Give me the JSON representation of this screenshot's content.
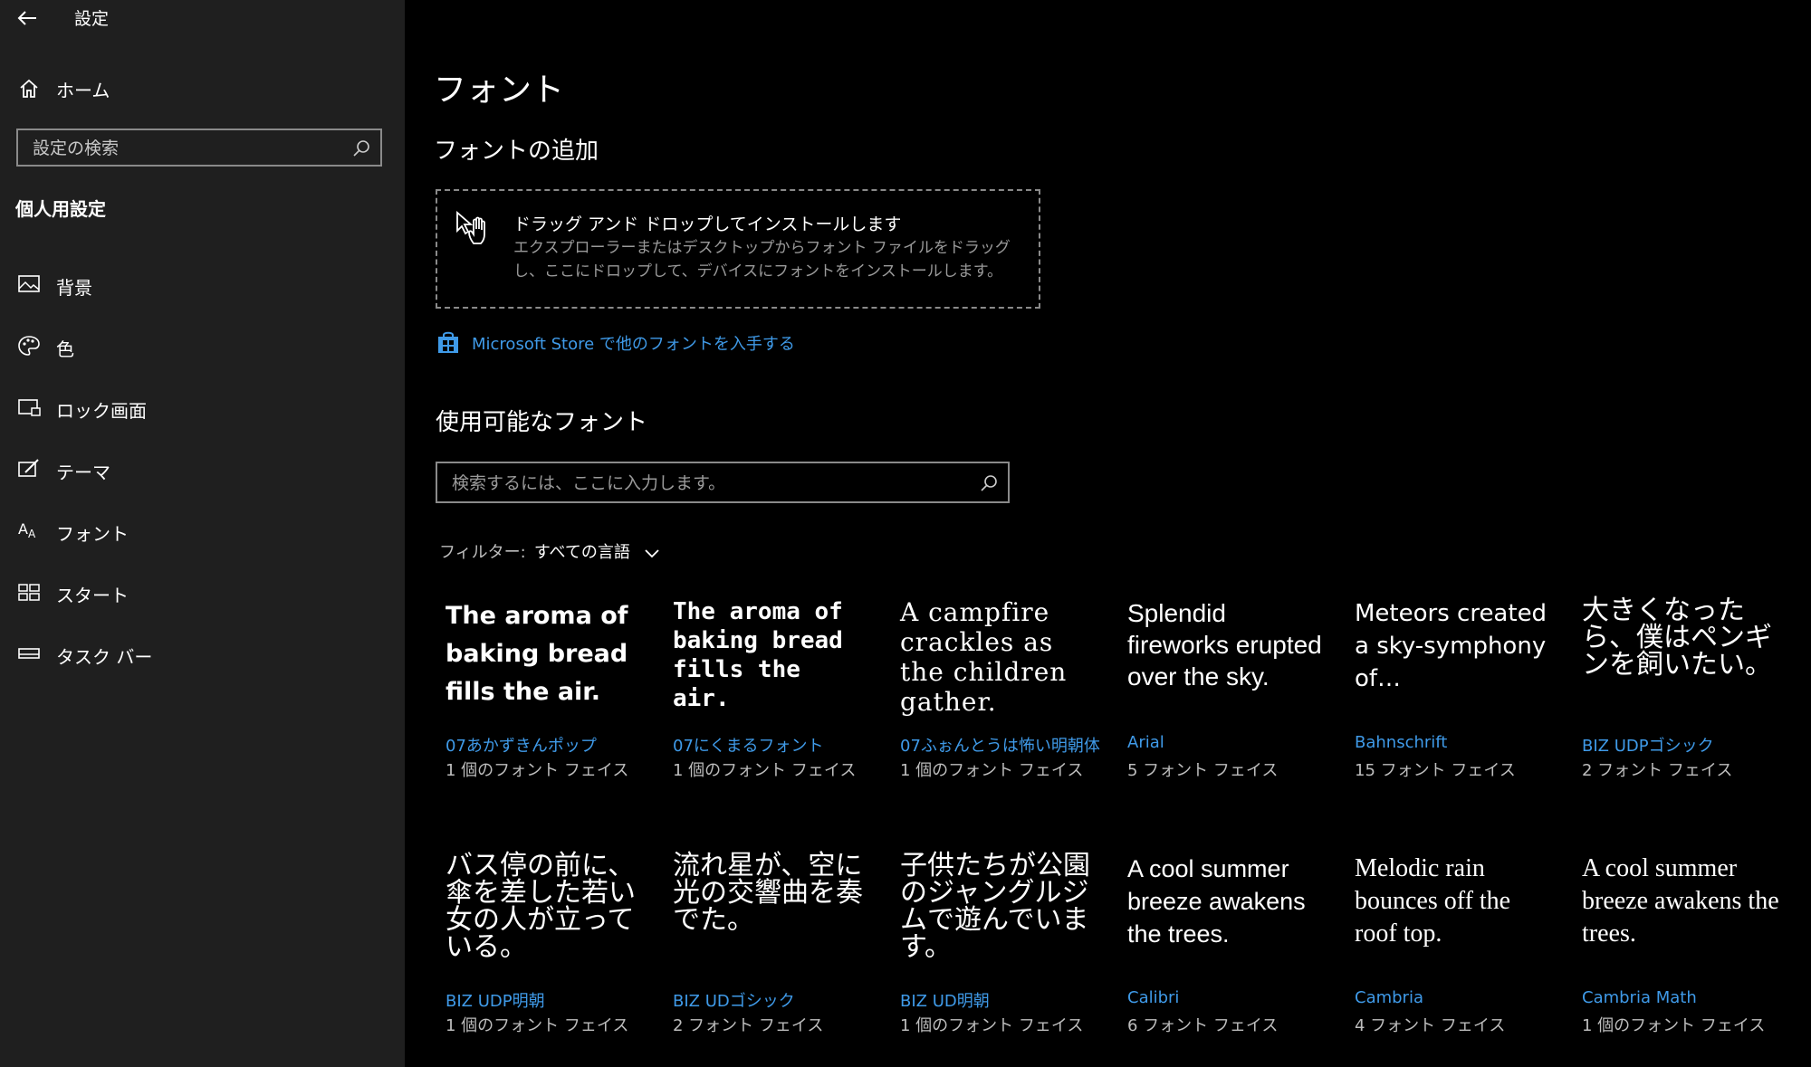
{
  "app": {
    "title": "設定"
  },
  "sidebar": {
    "home_label": "ホーム",
    "search_placeholder": "設定の検索",
    "section_heading": "個人用設定",
    "items": [
      {
        "label": "背景",
        "icon": "picture-icon"
      },
      {
        "label": "色",
        "icon": "palette-icon"
      },
      {
        "label": "ロック画面",
        "icon": "lock-screen-icon"
      },
      {
        "label": "テーマ",
        "icon": "theme-icon"
      },
      {
        "label": "フォント",
        "icon": "font-icon"
      },
      {
        "label": "スタート",
        "icon": "start-icon"
      },
      {
        "label": "タスク バー",
        "icon": "taskbar-icon"
      }
    ]
  },
  "main": {
    "page_title": "フォント",
    "add_title": "フォントの追加",
    "drop": {
      "title": "ドラッグ アンド ドロップしてインストールします",
      "description": "エクスプローラーまたはデスクトップからフォント ファイルをドラッグし、ここにドロップして、デバイスにフォントをインストールします。"
    },
    "store_link": "Microsoft Store で他のフォントを入手する",
    "available_title": "使用可能なフォント",
    "search_placeholder": "検索するには、ここに入力します。",
    "filter_label": "フィルター:",
    "filter_value": "すべての言語",
    "fonts": [
      {
        "sample": "The aroma of baking bread fills the air.",
        "name": "07あかずきんポップ",
        "count": "1 個のフォント フェイス"
      },
      {
        "sample": "The aroma of baking bread fills the air.",
        "name": "07にくまるフォント",
        "count": "1 個のフォント フェイス"
      },
      {
        "sample": "A campfire crackles as the children gather.",
        "name": "07ふぉんとうは怖い明朝体",
        "count": "1 個のフォント フェイス"
      },
      {
        "sample": "Splendid fireworks erupted over the sky.",
        "name": "Arial",
        "count": "5 フォント フェイス"
      },
      {
        "sample": "Meteors created a sky-symphony of…",
        "name": "Bahnschrift",
        "count": "15 フォント フェイス"
      },
      {
        "sample": "大きくなったら、僕はペンギンを飼いたい。",
        "name": "BIZ UDPゴシック",
        "count": "2 フォント フェイス"
      },
      {
        "sample": "バス停の前に、傘を差した若い女の人が立っている。",
        "name": "BIZ UDP明朝",
        "count": "1 個のフォント フェイス"
      },
      {
        "sample": "流れ星が、空に光の交響曲を奏でた。",
        "name": "BIZ UDゴシック",
        "count": "2 フォント フェイス"
      },
      {
        "sample": "子供たちが公園のジャングルジムで遊んでいます。",
        "name": "BIZ UD明朝",
        "count": "1 個のフォント フェイス"
      },
      {
        "sample": "A cool summer breeze awakens the trees.",
        "name": "Calibri",
        "count": "6 フォント フェイス"
      },
      {
        "sample": "Melodic rain bounces off the roof top.",
        "name": "Cambria",
        "count": "4 フォント フェイス"
      },
      {
        "sample": "A cool summer breeze awakens the trees.",
        "name": "Cambria Math",
        "count": "1 個のフォント フェイス"
      }
    ]
  },
  "colors": {
    "sidebar_bg": "#1f1f1f",
    "main_bg": "#000000",
    "link": "#3f9ae8",
    "secondary_text": "#bdbdbd"
  }
}
